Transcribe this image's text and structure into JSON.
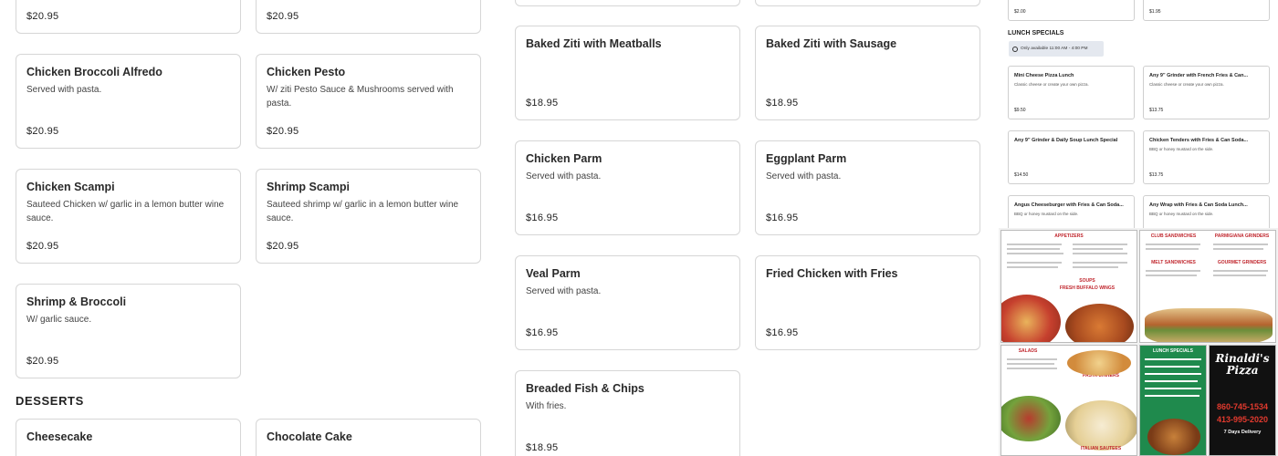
{
  "left_cards": [
    {
      "name": "",
      "desc": "",
      "price": "$20.95"
    },
    {
      "name": "",
      "desc": "",
      "price": "$20.95"
    },
    {
      "name": "Chicken Broccoli Alfredo",
      "desc": "Served with pasta.",
      "price": "$20.95"
    },
    {
      "name": "Chicken Pesto",
      "desc": "W/ ziti Pesto Sauce & Mushrooms served with pasta.",
      "price": "$20.95"
    },
    {
      "name": "Chicken Scampi",
      "desc": "Sauteed Chicken w/ garlic in a lemon butter wine sauce.",
      "price": "$20.95"
    },
    {
      "name": "Shrimp Scampi",
      "desc": "Sauteed shrimp w/ garlic in a lemon butter wine sauce.",
      "price": "$20.95"
    },
    {
      "name": "Shrimp & Broccoli",
      "desc": "W/ garlic sauce.",
      "price": "$20.95"
    }
  ],
  "desserts": {
    "title": "DESSERTS",
    "items": [
      {
        "name": "Cheesecake"
      },
      {
        "name": "Chocolate Cake"
      }
    ]
  },
  "mid_cards": [
    {
      "name": "Baked Ziti with Meatballs",
      "desc": "",
      "price": "$18.95"
    },
    {
      "name": "Baked Ziti with Sausage",
      "desc": "",
      "price": "$18.95"
    },
    {
      "name": "Chicken Parm",
      "desc": "Served with pasta.",
      "price": "$16.95"
    },
    {
      "name": "Eggplant Parm",
      "desc": "Served with pasta.",
      "price": "$16.95"
    },
    {
      "name": "Veal Parm",
      "desc": "Served with pasta.",
      "price": "$16.95"
    },
    {
      "name": "Fried Chicken with Fries",
      "desc": "",
      "price": "$16.95"
    },
    {
      "name": "Breaded Fish & Chips",
      "desc": "With fries.",
      "price": "$18.95"
    }
  ],
  "right_panel": {
    "top_prices": [
      "$2.00",
      "$1.95"
    ],
    "lunch_title": "LUNCH SPECIALS",
    "lunch_note": "Only available 11:00 AM - 4:00 PM",
    "items": [
      {
        "name": "Mini Cheese Pizza Lunch",
        "desc": "Classic cheese or create your own pizza.",
        "price": "$9.50"
      },
      {
        "name": "Any 9\" Grinder with French Fries & Can...",
        "desc": "Classic cheese or create your own pizza.",
        "price": "$13.75"
      },
      {
        "name": "Any 9\" Grinder & Daily Soup Lunch Special",
        "desc": "",
        "price": "$14.50"
      },
      {
        "name": "Chicken Tenders with Fries & Can Soda...",
        "desc": "BBQ or honey mustard on the side.",
        "price": "$13.75"
      },
      {
        "name": "Angus Cheeseburger with Fries & Can Soda...",
        "desc": "BBQ or honey mustard on the side.",
        "price": ""
      },
      {
        "name": "Any Wrap with Fries & Can Soda Lunch...",
        "desc": "BBQ or honey mustard on the side.",
        "price": ""
      }
    ],
    "flyer": {
      "appetizers": "APPETIZERS",
      "club_sandwiches": "CLUB SANDWICHES",
      "melt_sandwiches": "MELT SANDWICHES",
      "parmigiana_grinders": "PARMIGIANA GRINDERS",
      "gourmet_grinders": "GOURMET GRINDERS",
      "soups": "SOUPS",
      "fresh_buffalo_wings": "FRESH BUFFALO WINGS",
      "salads": "SALADS",
      "pasta_dinners": "PASTA DINNERS",
      "lunch_specials": "LUNCH SPECIALS",
      "italian_sautees": "ITALIAN SAUTEES",
      "brand": "Rinaldi's Pizza",
      "phone1": "860-745-1534",
      "phone2": "413-995-2020",
      "hours": "7 Days Delivery"
    }
  }
}
